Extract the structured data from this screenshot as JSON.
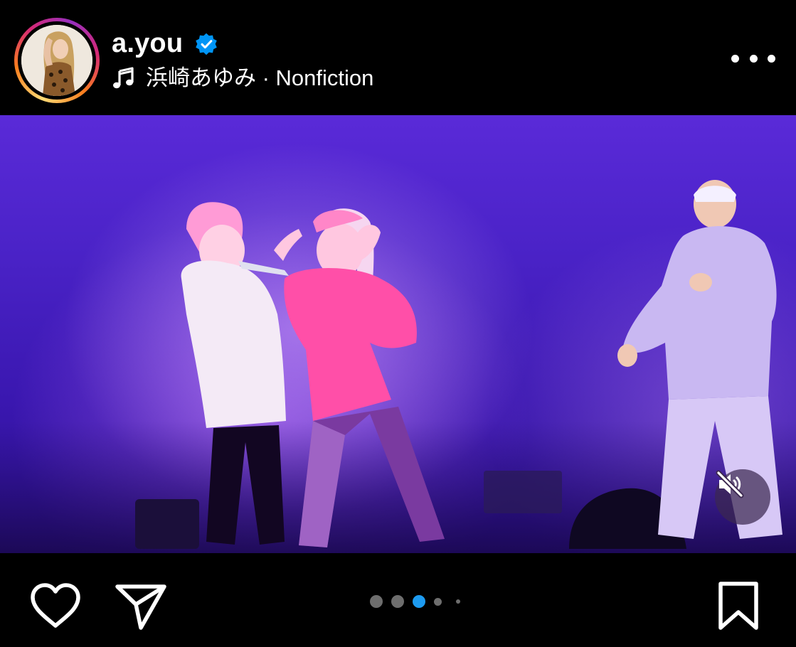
{
  "post_header": {
    "username": "a.you",
    "verified": true,
    "music_icon": "music-note-icon",
    "music_label": "浜崎あゆみ · Nonfiction",
    "more_icon": "more-horizontal-icon"
  },
  "media": {
    "description_icon": "concert-photo",
    "mute_icon": "speaker-muted-icon",
    "muted": true
  },
  "actions": {
    "like_icon": "heart-icon",
    "share_icon": "send-icon",
    "save_icon": "bookmark-icon"
  },
  "carousel": {
    "total": 5,
    "active_index": 3
  },
  "colors": {
    "background": "#000000",
    "accent_blue": "#1d9bf0",
    "verified_blue": "#0095f6",
    "inactive_dot": "#6e6e6e",
    "stage_purple": "#4b23c8"
  }
}
